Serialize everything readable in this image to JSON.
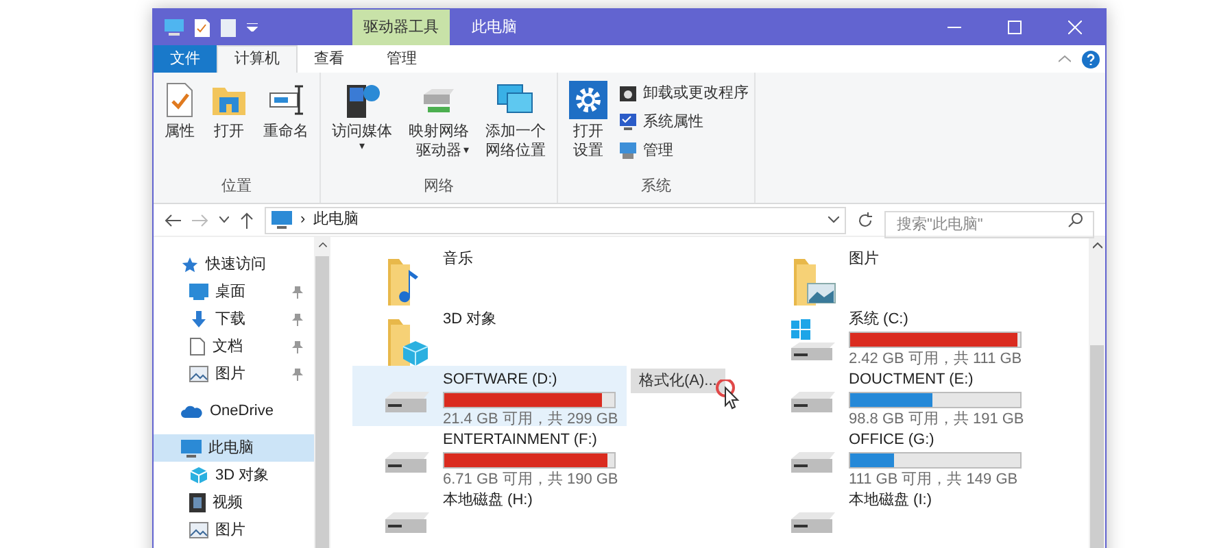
{
  "title_bar": {
    "context_tab": "驱动器工具",
    "title": "此电脑"
  },
  "tabs": [
    {
      "label": "文件",
      "kind": "file",
      "selected": false
    },
    {
      "label": "计算机",
      "kind": "normal",
      "selected": true
    },
    {
      "label": "查看",
      "kind": "normal",
      "selected": false
    },
    {
      "label": "管理",
      "kind": "context",
      "selected": false
    }
  ],
  "ribbon": {
    "groups": [
      {
        "label": "位置",
        "items": [
          {
            "kind": "large",
            "label": "属性"
          },
          {
            "kind": "large",
            "label": "打开"
          },
          {
            "kind": "large",
            "label": "重命名"
          }
        ]
      },
      {
        "label": "网络",
        "items": [
          {
            "kind": "large",
            "label": "访问媒体",
            "caret": "▾"
          },
          {
            "kind": "large",
            "label": "映射网络",
            "label2": "驱动器",
            "caret": "▾"
          },
          {
            "kind": "large",
            "label": "添加一个",
            "label2": "网络位置"
          }
        ]
      },
      {
        "label": "系统",
        "items": [
          {
            "kind": "large",
            "label": "打开",
            "label2": "设置"
          },
          {
            "kind": "small",
            "label": "卸载或更改程序"
          },
          {
            "kind": "small",
            "label": "系统属性"
          },
          {
            "kind": "small",
            "label": "管理"
          }
        ]
      }
    ]
  },
  "address": {
    "separator": "›",
    "path": "此电脑"
  },
  "search": {
    "placeholder": "搜索\"此电脑\""
  },
  "sidebar": {
    "items": [
      {
        "label": "快速访问",
        "selected": false,
        "children": [
          {
            "label": "桌面",
            "pinned": true,
            "selected": false
          },
          {
            "label": "下载",
            "pinned": true,
            "selected": false
          },
          {
            "label": "文档",
            "pinned": true,
            "selected": false
          },
          {
            "label": "图片",
            "pinned": true,
            "selected": false
          }
        ]
      },
      {
        "label": "OneDrive",
        "selected": false
      },
      {
        "label": "此电脑",
        "selected": true,
        "children": [
          {
            "label": "3D 对象",
            "pinned": false,
            "selected": false
          },
          {
            "label": "视频",
            "pinned": false,
            "selected": false
          },
          {
            "label": "图片",
            "pinned": false,
            "selected": false
          }
        ]
      }
    ]
  },
  "items": [
    {
      "kind": "folder",
      "name": "音乐",
      "selected": false
    },
    {
      "kind": "folder",
      "name": "图片",
      "selected": false
    },
    {
      "kind": "folder",
      "name": "3D 对象",
      "selected": false
    },
    {
      "kind": "drive",
      "name": "系统 (C:)",
      "level": 0.98,
      "color": "#da2b1f",
      "info": "2.42 GB 可用，共 111 GB",
      "selected": false
    },
    {
      "kind": "drive",
      "name": "SOFTWARE (D:)",
      "level": 0.93,
      "color": "#da2b1f",
      "info": "21.4 GB 可用，共 299 GB",
      "selected": true
    },
    {
      "kind": "drive",
      "name": "DOUCTMENT (E:)",
      "level": 0.48,
      "color": "#2589d8",
      "info": "98.8 GB 可用，共 191 GB",
      "selected": false
    },
    {
      "kind": "drive",
      "name": "ENTERTAINMENT (F:)",
      "level": 0.96,
      "color": "#da2b1f",
      "info": "6.71 GB 可用，共 190 GB",
      "selected": false
    },
    {
      "kind": "drive",
      "name": "OFFICE (G:)",
      "level": 0.26,
      "color": "#2589d8",
      "info": "111 GB 可用，共 149 GB",
      "selected": false
    },
    {
      "kind": "drive",
      "name": "本地磁盘 (H:)",
      "selected": false
    },
    {
      "kind": "drive",
      "name": "本地磁盘 (I:)",
      "selected": false
    }
  ],
  "context_menu": {
    "items": [
      {
        "label": "格式化(A)...",
        "selected": true
      }
    ]
  }
}
